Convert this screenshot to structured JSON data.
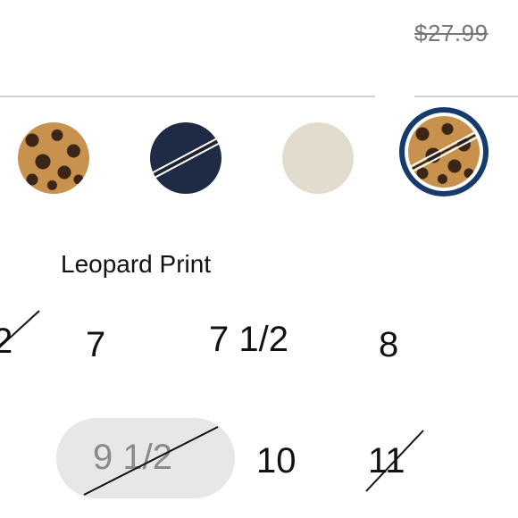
{
  "pricing": {
    "original_price": "$27.99"
  },
  "color": {
    "swatches": [
      {
        "name": "leopard-swatch",
        "available": true
      },
      {
        "name": "navy-swatch",
        "available": false
      },
      {
        "name": "cream-swatch",
        "available": true
      },
      {
        "name": "leopard-swatch-selected",
        "available": false,
        "selected": true
      }
    ],
    "selected_name": "Leopard Print"
  },
  "sizes": {
    "row1": [
      {
        "label": "2",
        "available": false
      },
      {
        "label": "7",
        "available": true
      },
      {
        "label": "7 1/2",
        "available": true
      },
      {
        "label": "8",
        "available": true
      }
    ],
    "row2": [
      {
        "label": "9 1/2",
        "available": false,
        "selected": true
      },
      {
        "label": "10",
        "available": true
      },
      {
        "label": "11",
        "available": false
      }
    ]
  },
  "colors": {
    "selected_ring": "#163a6b",
    "navy": "#1f2a44",
    "cream": "#e2dccf",
    "pill_bg": "#e7e7e7"
  }
}
